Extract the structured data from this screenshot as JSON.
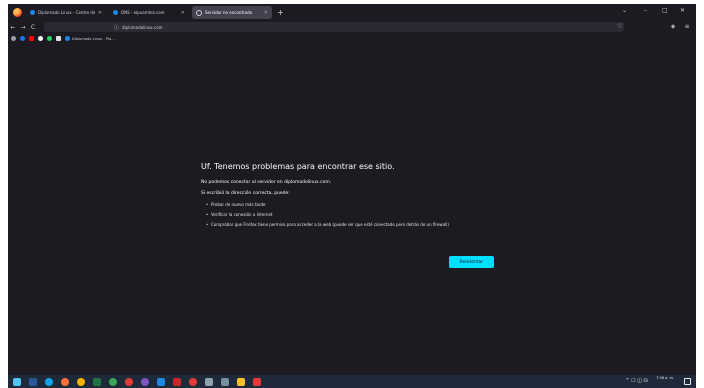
{
  "browser": {
    "tabs": [
      {
        "title": "Diplomado Linux - Centro de e...",
        "icon": "blue-dot-icon",
        "active": false
      },
      {
        "title": "DNS - elpuamtez.com",
        "icon": "blue-dot-icon",
        "active": false
      },
      {
        "title": "Servidor no encontrado",
        "icon": "globe-icon",
        "active": true
      }
    ],
    "new_tab": "+",
    "window_controls": {
      "minimize": "–",
      "maximize": "□",
      "close": "✕",
      "list": "⌄"
    },
    "nav": {
      "back": "←",
      "forward": "→",
      "reload": "C"
    },
    "url": "diplomadolinux.com",
    "bookmarks": [
      {
        "label": "Diplomado Linux - Pla..."
      }
    ]
  },
  "error_page": {
    "title": "Uf. Tenemos problemas para encontrar ese sitio.",
    "description": "No podemos conectar al servidor en diplomadolinux.com.",
    "intro": "Si escribió la dirección correcta, puede:",
    "suggestions": [
      "Probar de nuevo más tarde",
      "Verificar la conexión a Internet",
      "Comprobar que Firefox tiene permiso para acceder a la web (puede ser que esté conectado pero detrás de un firewall)"
    ],
    "retry_label": "Reintentar"
  },
  "taskbar": {
    "clock_time": "7:36 a. m.",
    "clock_date": "",
    "tray_icons": "^ ☐ ◫ ☊"
  },
  "colors": {
    "page_bg": "#1c1b22",
    "retry_button": "#00ddff",
    "taskbar": "#1e2a3a"
  }
}
